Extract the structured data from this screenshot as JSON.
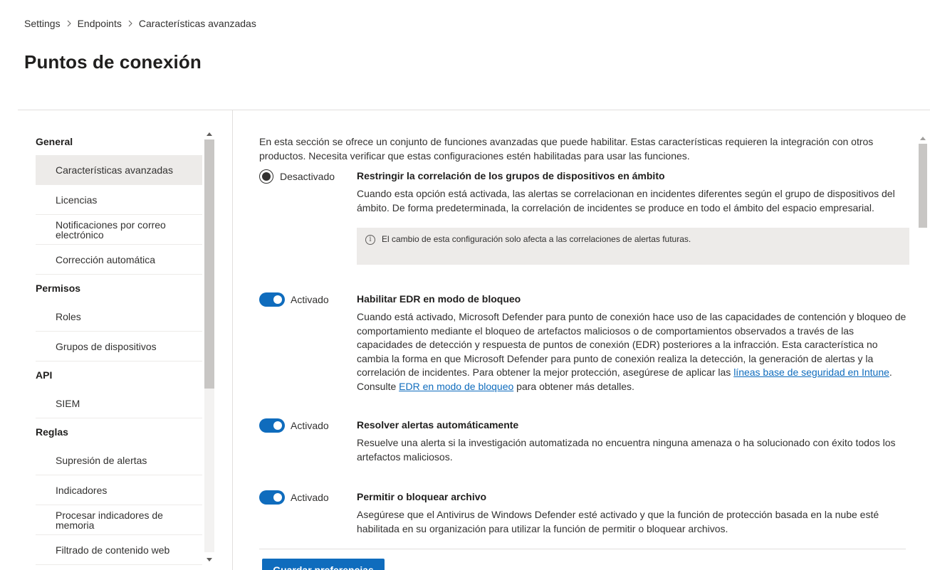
{
  "breadcrumb": {
    "items": [
      "Settings",
      "Endpoints",
      "Características avanzadas"
    ]
  },
  "page": {
    "title": "Puntos de conexión"
  },
  "nav": {
    "groups": [
      {
        "label": "General",
        "items": [
          "Características avanzadas",
          "Licencias",
          "Notificaciones por correo electrónico",
          "Corrección automática"
        ]
      },
      {
        "label": "Permisos",
        "items": [
          "Roles",
          "Grupos de dispositivos"
        ]
      },
      {
        "label": "API",
        "items": [
          "SIEM"
        ]
      },
      {
        "label": "Reglas",
        "items": [
          "Supresión de alertas",
          "Indicadores",
          "Procesar indicadores de memoria",
          "Filtrado de contenido web"
        ]
      }
    ],
    "selected": "Características avanzadas"
  },
  "main": {
    "intro": "En esta sección se ofrece un conjunto de funciones avanzadas que puede habilitar. Estas características requieren la integración con otros productos. Necesita verificar que estas configuraciones estén habilitadas para usar las funciones.",
    "settings": [
      {
        "control": "radio",
        "state_label": "Desactivado",
        "title": "Restringir la correlación de los grupos de dispositivos en ámbito",
        "description": "Cuando esta opción está activada, las alertas se correlacionan en incidentes diferentes según el grupo de dispositivos del ámbito. De forma predeterminada, la correlación de incidentes se produce en todo el ámbito del espacio empresarial.",
        "info": "El cambio de esta configuración solo afecta a las correlaciones de alertas futuras."
      },
      {
        "control": "toggle",
        "state_label": "Activado",
        "title": "Habilitar EDR en modo de bloqueo",
        "description_start": "Cuando está activado, Microsoft Defender para punto de conexión hace uso de las capacidades de contención y bloqueo de comportamiento mediante el bloqueo de artefactos maliciosos o de comportamientos observados a través de las capacidades de detección y respuesta de puntos de conexión (EDR) posteriores a la infracción. Esta característica no cambia la forma en que Microsoft Defender para punto de conexión realiza la detección, la generación de alertas y la correlación de incidentes. Para obtener la mejor protección, asegúrese de aplicar las ",
        "link1": "líneas base de seguridad en Intune",
        "description_mid": ". Consulte ",
        "link2": "EDR en modo de bloqueo",
        "description_end": " para obtener más detalles."
      },
      {
        "control": "toggle",
        "state_label": "Activado",
        "title": "Resolver alertas automáticamente",
        "description": "Resuelve una alerta si la investigación automatizada no encuentra ninguna amenaza o ha solucionado con éxito todos los artefactos maliciosos."
      },
      {
        "control": "toggle",
        "state_label": "Activado",
        "title": "Permitir o bloquear archivo",
        "description": "Asegúrese que el Antivirus de Windows Defender esté activado y que la función de protección basada en la nube esté habilitada en su organización para utilizar la función de permitir o bloquear archivos."
      }
    ],
    "save_label": "Guardar preferencias"
  },
  "colors": {
    "accent": "#0f6cbd",
    "selected_nav": "#edebe9",
    "info_box": "#edebe9"
  }
}
